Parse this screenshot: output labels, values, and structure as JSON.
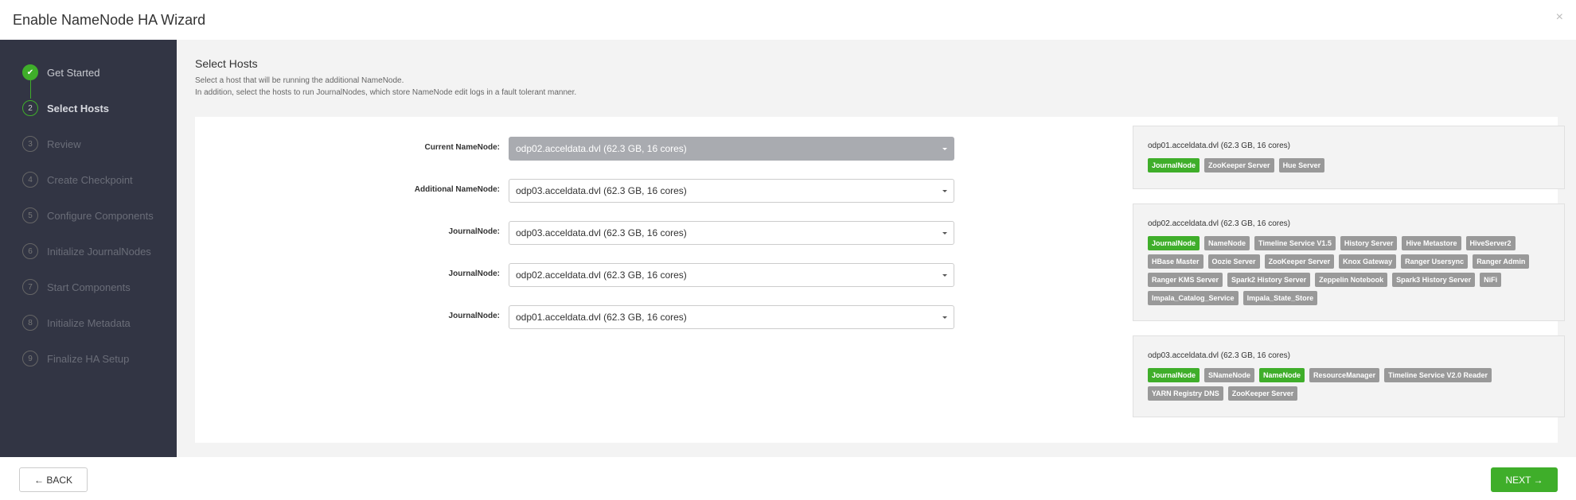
{
  "window": {
    "title": "Enable NameNode HA Wizard",
    "close_glyph": "×"
  },
  "steps": [
    {
      "num": "✔",
      "label": "Get Started",
      "state": "done"
    },
    {
      "num": "2",
      "label": "Select Hosts",
      "state": "current"
    },
    {
      "num": "3",
      "label": "Review",
      "state": "pending"
    },
    {
      "num": "4",
      "label": "Create Checkpoint",
      "state": "pending"
    },
    {
      "num": "5",
      "label": "Configure Components",
      "state": "pending"
    },
    {
      "num": "6",
      "label": "Initialize JournalNodes",
      "state": "pending"
    },
    {
      "num": "7",
      "label": "Start Components",
      "state": "pending"
    },
    {
      "num": "8",
      "label": "Initialize Metadata",
      "state": "pending"
    },
    {
      "num": "9",
      "label": "Finalize HA Setup",
      "state": "pending"
    }
  ],
  "main": {
    "title": "Select Hosts",
    "desc1": "Select a host that will be running the additional NameNode.",
    "desc2": "In addition, select the hosts to run JournalNodes, which store NameNode edit logs in a fault tolerant manner."
  },
  "assignments": [
    {
      "label": "Current NameNode:",
      "value": "odp02.acceldata.dvl (62.3 GB, 16 cores)",
      "disabled": true
    },
    {
      "label": "Additional NameNode:",
      "value": "odp03.acceldata.dvl (62.3 GB, 16 cores)",
      "disabled": false
    },
    {
      "label": "JournalNode:",
      "value": "odp03.acceldata.dvl (62.3 GB, 16 cores)",
      "disabled": false
    },
    {
      "label": "JournalNode:",
      "value": "odp02.acceldata.dvl (62.3 GB, 16 cores)",
      "disabled": false
    },
    {
      "label": "JournalNode:",
      "value": "odp01.acceldata.dvl (62.3 GB, 16 cores)",
      "disabled": false
    }
  ],
  "hosts": [
    {
      "name": "odp01.acceldata.dvl (62.3 GB, 16 cores)",
      "components": [
        {
          "label": "JournalNode",
          "highlight": true
        },
        {
          "label": "ZooKeeper Server",
          "highlight": false
        },
        {
          "label": "Hue Server",
          "highlight": false
        }
      ]
    },
    {
      "name": "odp02.acceldata.dvl (62.3 GB, 16 cores)",
      "components": [
        {
          "label": "JournalNode",
          "highlight": true
        },
        {
          "label": "NameNode",
          "highlight": false
        },
        {
          "label": "Timeline Service V1.5",
          "highlight": false
        },
        {
          "label": "History Server",
          "highlight": false
        },
        {
          "label": "Hive Metastore",
          "highlight": false
        },
        {
          "label": "HiveServer2",
          "highlight": false
        },
        {
          "label": "HBase Master",
          "highlight": false
        },
        {
          "label": "Oozie Server",
          "highlight": false
        },
        {
          "label": "ZooKeeper Server",
          "highlight": false
        },
        {
          "label": "Knox Gateway",
          "highlight": false
        },
        {
          "label": "Ranger Usersync",
          "highlight": false
        },
        {
          "label": "Ranger Admin",
          "highlight": false
        },
        {
          "label": "Ranger KMS Server",
          "highlight": false
        },
        {
          "label": "Spark2 History Server",
          "highlight": false
        },
        {
          "label": "Zeppelin Notebook",
          "highlight": false
        },
        {
          "label": "Spark3 History Server",
          "highlight": false
        },
        {
          "label": "NiFi",
          "highlight": false
        },
        {
          "label": "Impala_Catalog_Service",
          "highlight": false
        },
        {
          "label": "Impala_State_Store",
          "highlight": false
        }
      ]
    },
    {
      "name": "odp03.acceldata.dvl (62.3 GB, 16 cores)",
      "components": [
        {
          "label": "JournalNode",
          "highlight": true
        },
        {
          "label": "SNameNode",
          "highlight": false
        },
        {
          "label": "NameNode",
          "highlight": true
        },
        {
          "label": "ResourceManager",
          "highlight": false
        },
        {
          "label": "Timeline Service V2.0 Reader",
          "highlight": false
        },
        {
          "label": "YARN Registry DNS",
          "highlight": false
        },
        {
          "label": "ZooKeeper Server",
          "highlight": false
        }
      ]
    }
  ],
  "footer": {
    "back_label": "← BACK",
    "next_label": "NEXT →"
  },
  "colors": {
    "accent": "#3fae2a",
    "sidebar_bg": "#323544",
    "badge_gray": "#999999"
  }
}
